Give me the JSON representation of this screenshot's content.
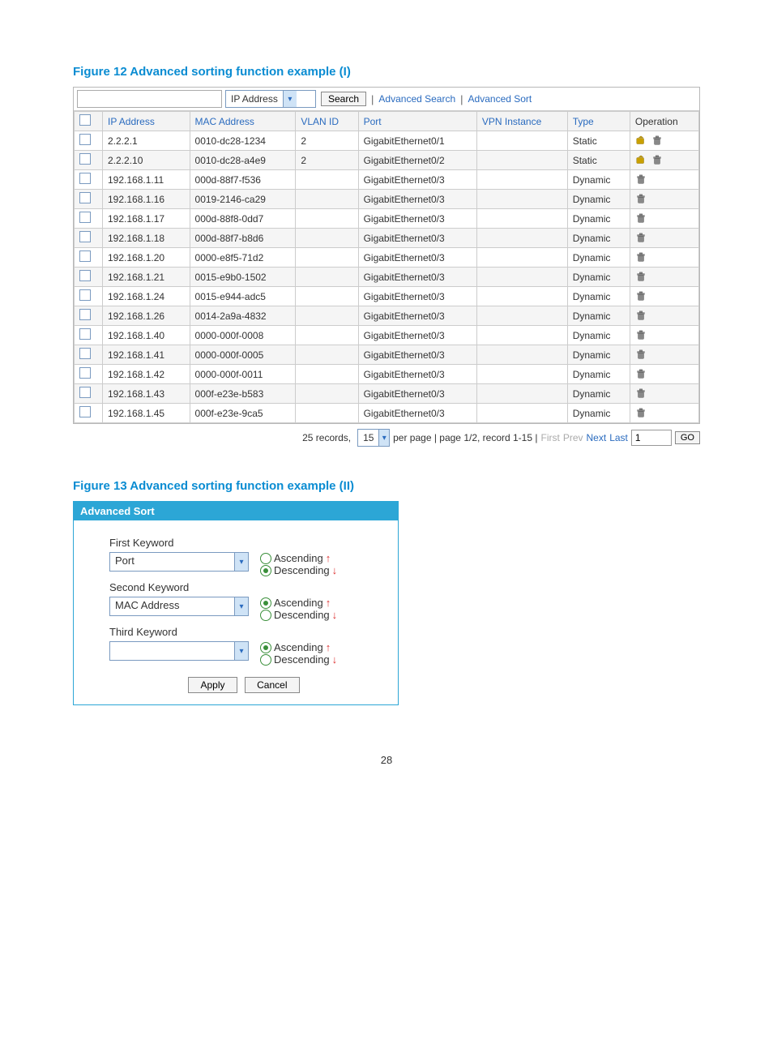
{
  "fig12": {
    "caption": "Figure 12 Advanced sorting function example (I)",
    "search_value": "",
    "dropdown_value": "IP Address",
    "search_btn": "Search",
    "adv_search": "Advanced Search",
    "adv_sort": "Advanced Sort",
    "columns": [
      "IP Address",
      "MAC Address",
      "VLAN ID",
      "Port",
      "VPN Instance",
      "Type",
      "Operation"
    ],
    "rows": [
      {
        "ip": "2.2.2.1",
        "mac": "0010-dc28-1234",
        "vlan": "2",
        "port": "GigabitEthernet0/1",
        "vpn": "",
        "type": "Static",
        "edit": true
      },
      {
        "ip": "2.2.2.10",
        "mac": "0010-dc28-a4e9",
        "vlan": "2",
        "port": "GigabitEthernet0/2",
        "vpn": "",
        "type": "Static",
        "edit": true
      },
      {
        "ip": "192.168.1.11",
        "mac": "000d-88f7-f536",
        "vlan": "",
        "port": "GigabitEthernet0/3",
        "vpn": "",
        "type": "Dynamic",
        "edit": false
      },
      {
        "ip": "192.168.1.16",
        "mac": "0019-2146-ca29",
        "vlan": "",
        "port": "GigabitEthernet0/3",
        "vpn": "",
        "type": "Dynamic",
        "edit": false
      },
      {
        "ip": "192.168.1.17",
        "mac": "000d-88f8-0dd7",
        "vlan": "",
        "port": "GigabitEthernet0/3",
        "vpn": "",
        "type": "Dynamic",
        "edit": false
      },
      {
        "ip": "192.168.1.18",
        "mac": "000d-88f7-b8d6",
        "vlan": "",
        "port": "GigabitEthernet0/3",
        "vpn": "",
        "type": "Dynamic",
        "edit": false
      },
      {
        "ip": "192.168.1.20",
        "mac": "0000-e8f5-71d2",
        "vlan": "",
        "port": "GigabitEthernet0/3",
        "vpn": "",
        "type": "Dynamic",
        "edit": false
      },
      {
        "ip": "192.168.1.21",
        "mac": "0015-e9b0-1502",
        "vlan": "",
        "port": "GigabitEthernet0/3",
        "vpn": "",
        "type": "Dynamic",
        "edit": false
      },
      {
        "ip": "192.168.1.24",
        "mac": "0015-e944-adc5",
        "vlan": "",
        "port": "GigabitEthernet0/3",
        "vpn": "",
        "type": "Dynamic",
        "edit": false
      },
      {
        "ip": "192.168.1.26",
        "mac": "0014-2a9a-4832",
        "vlan": "",
        "port": "GigabitEthernet0/3",
        "vpn": "",
        "type": "Dynamic",
        "edit": false
      },
      {
        "ip": "192.168.1.40",
        "mac": "0000-000f-0008",
        "vlan": "",
        "port": "GigabitEthernet0/3",
        "vpn": "",
        "type": "Dynamic",
        "edit": false
      },
      {
        "ip": "192.168.1.41",
        "mac": "0000-000f-0005",
        "vlan": "",
        "port": "GigabitEthernet0/3",
        "vpn": "",
        "type": "Dynamic",
        "edit": false
      },
      {
        "ip": "192.168.1.42",
        "mac": "0000-000f-0011",
        "vlan": "",
        "port": "GigabitEthernet0/3",
        "vpn": "",
        "type": "Dynamic",
        "edit": false
      },
      {
        "ip": "192.168.1.43",
        "mac": "000f-e23e-b583",
        "vlan": "",
        "port": "GigabitEthernet0/3",
        "vpn": "",
        "type": "Dynamic",
        "edit": false
      },
      {
        "ip": "192.168.1.45",
        "mac": "000f-e23e-9ca5",
        "vlan": "",
        "port": "GigabitEthernet0/3",
        "vpn": "",
        "type": "Dynamic",
        "edit": false
      }
    ],
    "pager": {
      "records_prefix": "25 records,",
      "per_page_value": "15",
      "per_page_suffix": "per page | page 1/2, record 1-15 |",
      "first": "First",
      "prev": "Prev",
      "next": "Next",
      "last": "Last",
      "page_input": "1",
      "go": "GO"
    }
  },
  "fig13": {
    "caption": "Figure 13 Advanced sorting function example (II)",
    "title": "Advanced Sort",
    "kw1_label": "First Keyword",
    "kw1_value": "Port",
    "kw2_label": "Second Keyword",
    "kw2_value": "MAC Address",
    "kw3_label": "Third Keyword",
    "kw3_value": "",
    "asc": "Ascending",
    "desc": "Descending",
    "kw1_sel": "desc",
    "kw2_sel": "asc",
    "kw3_sel": "asc",
    "apply": "Apply",
    "cancel": "Cancel"
  },
  "page_number": "28"
}
